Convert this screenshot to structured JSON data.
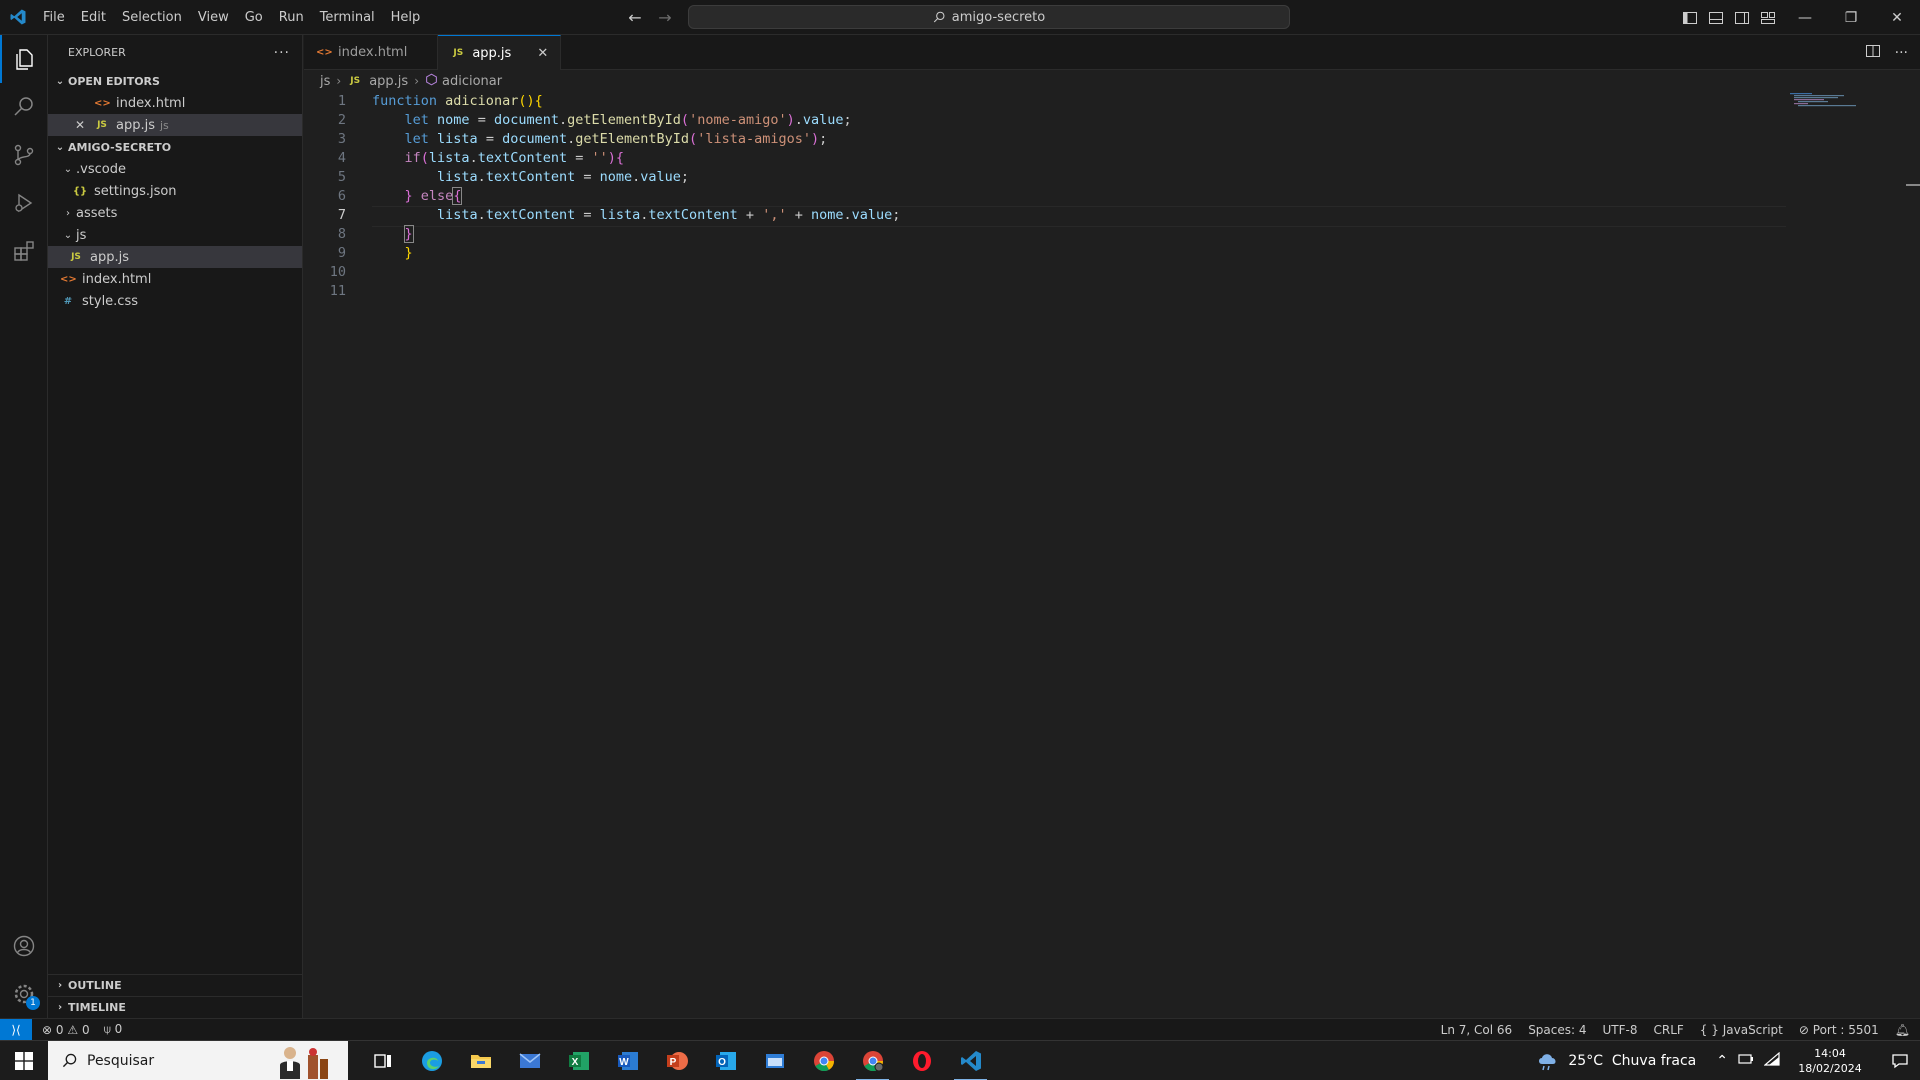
{
  "titlebar": {
    "menu": [
      "File",
      "Edit",
      "Selection",
      "View",
      "Go",
      "Run",
      "Terminal",
      "Help"
    ],
    "search_text": "amigo-secreto"
  },
  "sidebar": {
    "title": "EXPLORER",
    "open_editors_label": "OPEN EDITORS",
    "open_editors": [
      {
        "name": "index.html",
        "type": "html"
      },
      {
        "name": "app.js",
        "type": "js",
        "hint": "js"
      }
    ],
    "project_label": "AMIGO-SECRETO",
    "tree": {
      "vscode_folder": ".vscode",
      "settings_file": "settings.json",
      "assets_folder": "assets",
      "js_folder": "js",
      "app_file": "app.js",
      "index_file": "index.html",
      "style_file": "style.css"
    },
    "outline_label": "OUTLINE",
    "timeline_label": "TIMELINE"
  },
  "tabs": [
    {
      "label": "index.html",
      "type": "html"
    },
    {
      "label": "app.js",
      "type": "js"
    }
  ],
  "breadcrumb": {
    "folder": "js",
    "file": "app.js",
    "symbol": "adicionar"
  },
  "editor": {
    "current_line": 7,
    "line_numbers": [
      "1",
      "2",
      "3",
      "4",
      "5",
      "6",
      "7",
      "8",
      "9",
      "10",
      "11"
    ],
    "code": {
      "l1_kw": "function",
      "l1_fn": "adicionar",
      "l2_kw": "let",
      "l2_var": "nome",
      "l2_obj": "document",
      "l2_fn": "getElementById",
      "l2_str": "'nome-amigo'",
      "l2_prop": "value",
      "l3_kw": "let",
      "l3_var": "lista",
      "l3_obj": "document",
      "l3_fn": "getElementById",
      "l3_str": "'lista-amigos'",
      "l4_kw": "if",
      "l4_var": "lista",
      "l4_prop": "textContent",
      "l4_str": "''",
      "l5_var": "lista",
      "l5_prop": "textContent",
      "l5_var2": "nome",
      "l5_prop2": "value",
      "l6_kw": "else",
      "l7_var": "lista",
      "l7_prop": "textContent",
      "l7_var2": "lista",
      "l7_prop2": "textContent",
      "l7_str": "','",
      "l7_var3": "nome",
      "l7_prop3": "value"
    }
  },
  "statusbar": {
    "errors": "0",
    "warnings": "0",
    "ports": "0",
    "position": "Ln 7, Col 66",
    "spaces": "Spaces: 4",
    "encoding": "UTF-8",
    "eol": "CRLF",
    "language": "JavaScript",
    "port": "Port : 5501"
  },
  "taskbar": {
    "search_placeholder": "Pesquisar",
    "weather": "25°C  Chuva fraca",
    "time": "14:04",
    "date": "18/02/2024",
    "apps": [
      "task-view",
      "edge",
      "file-explorer",
      "mail",
      "excel",
      "word",
      "powerpoint",
      "outlook",
      "app-window",
      "chrome",
      "chrome-profile",
      "opera",
      "vscode"
    ]
  },
  "colors": {
    "accent": "#0078d4",
    "editor_bg": "#1f1f1f",
    "sidebar_bg": "#181818"
  }
}
